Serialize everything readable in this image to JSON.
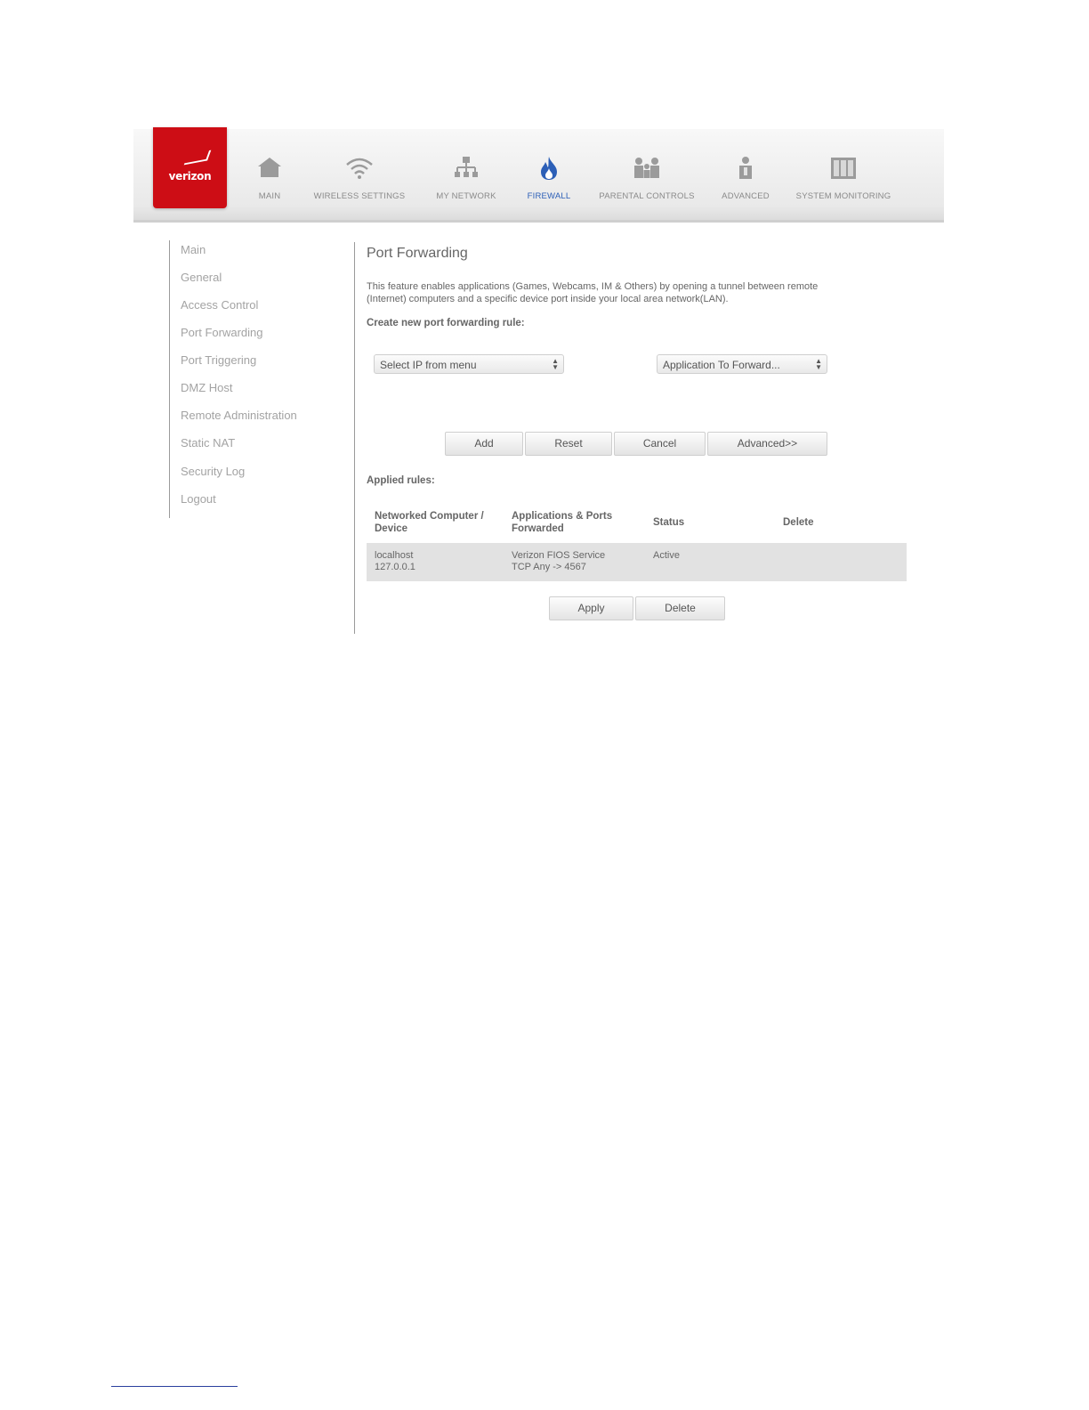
{
  "brand": {
    "logo_text": "verizon"
  },
  "nav": {
    "items": [
      {
        "label": "MAIN",
        "icon": "home-icon"
      },
      {
        "label": "WIRELESS SETTINGS",
        "icon": "wifi-icon"
      },
      {
        "label": "MY NETWORK",
        "icon": "network-icon"
      },
      {
        "label": "FIREWALL",
        "icon": "flame-icon",
        "active": true
      },
      {
        "label": "PARENTAL CONTROLS",
        "icon": "parental-icon"
      },
      {
        "label": "ADVANCED",
        "icon": "advanced-icon"
      },
      {
        "label": "SYSTEM MONITORING",
        "icon": "monitor-icon"
      }
    ],
    "active_color": "#2c5fb7"
  },
  "sidebar": {
    "items": [
      {
        "label": "Main"
      },
      {
        "label": "General"
      },
      {
        "label": "Access Control"
      },
      {
        "label": "Port Forwarding"
      },
      {
        "label": "Port Triggering"
      },
      {
        "label": "DMZ Host"
      },
      {
        "label": "Remote Administration"
      },
      {
        "label": "Static NAT"
      },
      {
        "label": "Security Log"
      },
      {
        "label": "Logout"
      }
    ]
  },
  "main": {
    "title": "Port Forwarding",
    "description_line1": "This feature enables applications (Games, Webcams, IM & Others) by opening a tunnel between remote",
    "description_line2": "(Internet) computers and a specific device port inside your local area network(LAN).",
    "create_heading": "Create new port forwarding rule:",
    "ip_select": {
      "value": "Select IP from menu"
    },
    "app_select": {
      "value": "Application To Forward..."
    },
    "buttons": {
      "add": "Add",
      "reset": "Reset",
      "cancel": "Cancel",
      "advanced": "Advanced>>"
    },
    "applied_heading": "Applied rules:",
    "table": {
      "headers": [
        "Networked Computer / Device",
        "Applications & Ports Forwarded",
        "Status",
        "Delete"
      ],
      "rows": [
        {
          "device_name": "localhost",
          "device_ip": "127.0.0.1",
          "application": "Verizon FIOS Service",
          "ports": "TCP Any -> 4567",
          "status": "Active"
        }
      ]
    },
    "footer_buttons": {
      "apply": "Apply",
      "delete": "Delete"
    }
  },
  "colors": {
    "brand_red": "#cd0d15",
    "active_nav": "#2c5fb7"
  }
}
